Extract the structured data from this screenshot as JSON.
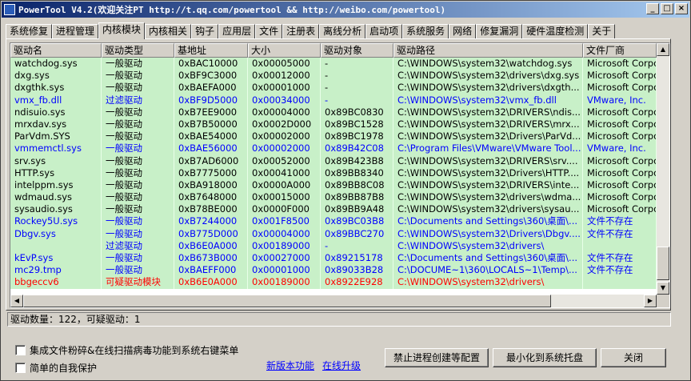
{
  "window": {
    "title": "PowerTool V4.2(欢迎关注PT http://t.qq.com/powertool && http://weibo.com/powertool)"
  },
  "tabs": [
    "系统修复",
    "进程管理",
    "内核模块",
    "内核相关",
    "钩子",
    "应用层",
    "文件",
    "注册表",
    "离线分析",
    "启动项",
    "系统服务",
    "网络",
    "修复漏洞",
    "硬件温度检测",
    "关于"
  ],
  "active_tab": "内核模块",
  "columns": [
    "驱动名",
    "驱动类型",
    "基地址",
    "大小",
    "驱动对象",
    "驱动路径",
    "文件厂商"
  ],
  "colors": {
    "normal": "#000000",
    "filter": "#0000ff",
    "suspicious": "#ff0000",
    "row_bg": "#c8f0c8"
  },
  "rows": [
    {
      "cells": [
        "watchdog.sys",
        "一般驱动",
        "0xBAC10000",
        "0x00005000",
        "-",
        "C:\\WINDOWS\\system32\\watchdog.sys",
        "Microsoft Corpo"
      ],
      "kind": "normal"
    },
    {
      "cells": [
        "dxg.sys",
        "一般驱动",
        "0xBF9C3000",
        "0x00012000",
        "-",
        "C:\\WINDOWS\\system32\\drivers\\dxg.sys",
        "Microsoft Corpo"
      ],
      "kind": "normal"
    },
    {
      "cells": [
        "dxgthk.sys",
        "一般驱动",
        "0xBAEFA000",
        "0x00001000",
        "-",
        "C:\\WINDOWS\\system32\\drivers\\dxgth...",
        "Microsoft Corpo"
      ],
      "kind": "normal"
    },
    {
      "cells": [
        "vmx_fb.dll",
        "过滤驱动",
        "0xBF9D5000",
        "0x00034000",
        "-",
        "C:\\WINDOWS\\system32\\vmx_fb.dll",
        "VMware, Inc."
      ],
      "kind": "filter"
    },
    {
      "cells": [
        "ndisuio.sys",
        "一般驱动",
        "0xB7EE9000",
        "0x00004000",
        "0x89BC0830",
        "C:\\WINDOWS\\system32\\DRIVERS\\ndis...",
        "Microsoft Corpo"
      ],
      "kind": "normal"
    },
    {
      "cells": [
        "mrxdav.sys",
        "一般驱动",
        "0xB7B50000",
        "0x0002D000",
        "0x89BC1528",
        "C:\\WINDOWS\\system32\\DRIVERS\\mrx...",
        "Microsoft Corpo"
      ],
      "kind": "normal"
    },
    {
      "cells": [
        "ParVdm.SYS",
        "一般驱动",
        "0xBAE54000",
        "0x00002000",
        "0x89BC1978",
        "C:\\WINDOWS\\system32\\Drivers\\ParVd...",
        "Microsoft Corpo"
      ],
      "kind": "normal"
    },
    {
      "cells": [
        "vmmemctl.sys",
        "一般驱动",
        "0xBAE56000",
        "0x00002000",
        "0x89B42C08",
        "C:\\Program Files\\VMware\\VMware Tool...",
        "VMware, Inc."
      ],
      "kind": "filter"
    },
    {
      "cells": [
        "srv.sys",
        "一般驱动",
        "0xB7AD6000",
        "0x00052000",
        "0x89B423B8",
        "C:\\WINDOWS\\system32\\DRIVERS\\srv....",
        "Microsoft Corpo"
      ],
      "kind": "normal"
    },
    {
      "cells": [
        "HTTP.sys",
        "一般驱动",
        "0xB7775000",
        "0x00041000",
        "0x89BB8340",
        "C:\\WINDOWS\\system32\\Drivers\\HTTP....",
        "Microsoft Corpo"
      ],
      "kind": "normal"
    },
    {
      "cells": [
        "intelppm.sys",
        "一般驱动",
        "0xBA918000",
        "0x0000A000",
        "0x89BB8C08",
        "C:\\WINDOWS\\system32\\DRIVERS\\inte...",
        "Microsoft Corpo"
      ],
      "kind": "normal"
    },
    {
      "cells": [
        "wdmaud.sys",
        "一般驱动",
        "0xB7648000",
        "0x00015000",
        "0x89BB87B8",
        "C:\\WINDOWS\\system32\\drivers\\wdma...",
        "Microsoft Corpo"
      ],
      "kind": "normal"
    },
    {
      "cells": [
        "sysaudio.sys",
        "一般驱动",
        "0xB78BE000",
        "0x0000F000",
        "0x89BB9A48",
        "C:\\WINDOWS\\system32\\drivers\\sysau...",
        "Microsoft Corpo"
      ],
      "kind": "normal"
    },
    {
      "cells": [
        "Rockey5U.sys",
        "一般驱动",
        "0xB7244000",
        "0x001F8500",
        "0x89BC03B8",
        "C:\\Documents and Settings\\360\\桌面\\...",
        "文件不存在"
      ],
      "kind": "filter"
    },
    {
      "cells": [
        "Dbgv.sys",
        "一般驱动",
        "0xB775D000",
        "0x00004000",
        "0x89BBC270",
        "C:\\WINDOWS\\system32\\Drivers\\Dbgv....",
        "文件不存在"
      ],
      "kind": "filter"
    },
    {
      "cells": [
        "",
        "过滤驱动",
        "0xB6E0A000",
        "0x00189000",
        "-",
        "C:\\WINDOWS\\system32\\drivers\\",
        ""
      ],
      "kind": "filter"
    },
    {
      "cells": [
        "kEvP.sys",
        "一般驱动",
        "0xB673B000",
        "0x00027000",
        "0x89215178",
        "C:\\Documents and Settings\\360\\桌面\\...",
        "文件不存在"
      ],
      "kind": "filter"
    },
    {
      "cells": [
        "mc29.tmp",
        "一般驱动",
        "0xBAEFF000",
        "0x00001000",
        "0x89033B28",
        "C:\\DOCUME~1\\360\\LOCALS~1\\Temp\\...",
        "文件不存在"
      ],
      "kind": "filter"
    },
    {
      "cells": [
        "bbgeccv6",
        "可疑驱动模块",
        "0xB6E0A000",
        "0x00189000",
        "0x8922E928",
        "C:\\WINDOWS\\system32\\drivers\\",
        ""
      ],
      "kind": "suspicious"
    }
  ],
  "status": {
    "text": "驱动数量：122，可疑驱动：1"
  },
  "options": {
    "shell_integration": "集成文件粉碎&在线扫描病毒功能到系统右键菜单",
    "self_protect": "简单的自我保护"
  },
  "links": {
    "new_features": "新版本功能",
    "online_upgrade": "在线升级"
  },
  "buttons": {
    "block": "禁止进程创建等配置",
    "minimize_tray": "最小化到系统托盘",
    "close": "关闭"
  },
  "icons": {
    "minimize": "_",
    "maximize": "□",
    "close": "×"
  }
}
